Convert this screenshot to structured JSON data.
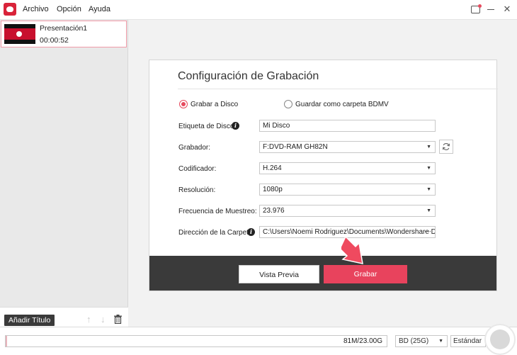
{
  "menu": {
    "items": [
      "Archivo",
      "Opción",
      "Ayuda"
    ]
  },
  "window_controls": {
    "close_glyph": "✕"
  },
  "titles_panel": {
    "items": [
      {
        "name": "Presentación1",
        "duration": "00:00:52"
      }
    ],
    "add_title_label": "Añadir Título",
    "up_glyph": "↑",
    "down_glyph": "↓"
  },
  "burn_dialog": {
    "title": "Configuración de Grabación",
    "options": {
      "burn_to_disc": "Grabar a Disco",
      "save_as_bdmv": "Guardar como carpeta BDMV",
      "selected": "burn_to_disc"
    },
    "fields": {
      "disc_label": {
        "label": "Etiqueta de Disco:",
        "value": "Mi Disco"
      },
      "burner": {
        "label": "Grabador:",
        "value": "F:DVD-RAM GH82N"
      },
      "encoder": {
        "label": "Codificador:",
        "value": "H.264"
      },
      "resolution": {
        "label": "Resolución:",
        "value": "1080p"
      },
      "frame_rate": {
        "label": "Frecuencia de Muestreo:",
        "value": "23.976"
      },
      "folder_path": {
        "label": "Dirección de la Carpeta:",
        "value": "C:\\Users\\Noemi Rodriguez\\Documents\\Wondershare DVD C",
        "browse_glyph": "···"
      }
    },
    "buttons": {
      "preview": "Vista Previa",
      "burn": "Grabar"
    },
    "info_glyph": "i",
    "caret_glyph": "▼"
  },
  "status_bar": {
    "size_text": "81M/23.00G",
    "size_fraction": 0.0035,
    "disc_type": "BD (25G)",
    "quality": "Estándar"
  },
  "colors": {
    "accent": "#e8435d",
    "dialog_footer": "#3a3a3a",
    "selection_border": "#f19aa8"
  },
  "icons": {
    "logo": "app-logo-icon",
    "feedback": "feedback-icon",
    "minimize": "minimize-icon",
    "close": "close-icon",
    "refresh": "refresh-icon",
    "info": "info-icon",
    "trash": "trash-icon",
    "up": "arrow-up-icon",
    "down": "arrow-down-icon",
    "annotation": "red-arrow-icon"
  }
}
